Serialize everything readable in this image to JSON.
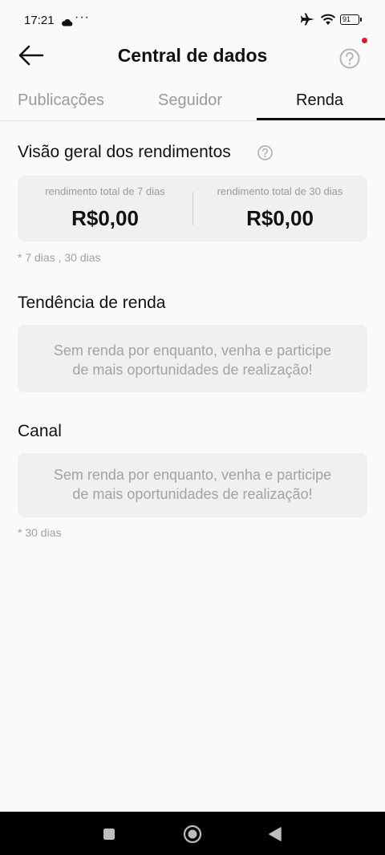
{
  "status_bar": {
    "time": "17:21",
    "dots": "···",
    "battery": "91"
  },
  "header": {
    "title": "Central de dados"
  },
  "tabs": [
    {
      "label": "Publicações",
      "active": false
    },
    {
      "label": "Seguidor",
      "active": false
    },
    {
      "label": "Renda",
      "active": true
    }
  ],
  "overview": {
    "title": "Visão geral dos rendimentos",
    "stats": [
      {
        "label": "rendimento total de 7 dias",
        "value": "R$0,00"
      },
      {
        "label": "rendimento total de 30 dias",
        "value": "R$0,00"
      }
    ],
    "footnote": "* 7 dias , 30 dias"
  },
  "trend": {
    "title": "Tendência de renda",
    "empty_line1": "Sem renda por enquanto, venha e participe",
    "empty_line2": "de mais oportunidades de realização!"
  },
  "channel": {
    "title": "Canal",
    "empty_line1": "Sem renda por enquanto, venha e participe",
    "empty_line2": "de mais oportunidades de realização!",
    "footnote": "* 30 dias"
  },
  "colors": {
    "notification_dot": "#e0182d",
    "card_bg": "#f0f0f0",
    "muted_text": "#9a9a9a"
  }
}
